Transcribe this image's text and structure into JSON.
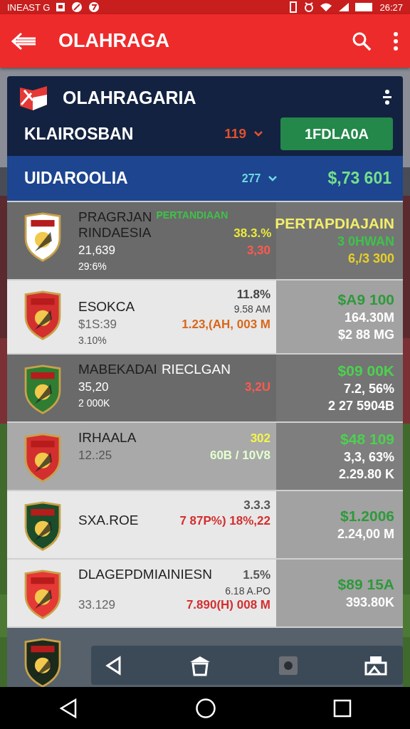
{
  "status_bar": {
    "carrier": "INEAST G",
    "time": "26:27"
  },
  "app_bar": {
    "title": "OLAHRAGA"
  },
  "card": {
    "title": "OLAHRAGARIA",
    "summary": {
      "label": "KLAIROSBAN",
      "count": "119",
      "button": "1FDLA0A"
    },
    "league": {
      "label": "UIDAROOLIA",
      "count": "277",
      "amount": "$,73 601"
    },
    "rows": [
      {
        "kind": "dark",
        "color": "#ffffff",
        "lines": [
          {
            "left": [
              {
                "kind": "name",
                "text": "PRAGRJAN RINDAESIA",
                "color": "#1e1e1e"
              },
              {
                "kind": "tag",
                "text": "PERTANDIAAN",
                "color": "#3fc24a"
              }
            ],
            "right": [
              {
                "kind": "value",
                "text": "38.3.%",
                "color": "#ecea3a"
              }
            ]
          },
          {
            "left": [
              {
                "kind": "stat",
                "text": "21,639",
                "color": "#ffffff"
              }
            ],
            "right": [
              {
                "kind": "value",
                "text": "3,30",
                "color": "#ff5a4f"
              }
            ]
          },
          {
            "left": [
              {
                "kind": "small",
                "text": "29:6%",
                "color": "#ffffff"
              }
            ]
          }
        ],
        "right": [
          {
            "text": "PERTAPDIAJAIN",
            "color": "#f2ee6a"
          },
          {
            "text": "3 0HWAN",
            "color": "#3fc24a"
          },
          {
            "text": "6,/3 300",
            "color": "#e5d02a"
          }
        ]
      },
      {
        "kind": "light",
        "color": "#d32f2f",
        "lines": [
          {
            "left": [
              {
                "kind": "name",
                "text": "ESOKCA",
                "color": "#1e1e1e"
              }
            ],
            "right": [
              {
                "kind": "value",
                "text": "11.8%",
                "color": "#444444"
              },
              {
                "kind": "small",
                "text": "9.58 AM",
                "color": "#444444"
              }
            ]
          },
          {
            "left": [
              {
                "kind": "stat",
                "text": "$1S:39",
                "color": "#666666"
              }
            ],
            "right": [
              {
                "kind": "value",
                "text": "1.23,(AH, 003 M",
                "color": "#d9661a"
              }
            ]
          },
          {
            "left": [
              {
                "kind": "small",
                "text": "3.10%",
                "color": "#555555"
              }
            ]
          }
        ],
        "right": [
          {
            "text": "$A9 100",
            "color": "#2e9a3a"
          },
          {
            "text": "164.30M",
            "color": "#ffffff"
          },
          {
            "text": "$2 88 MG",
            "color": "#ffffff"
          }
        ]
      },
      {
        "kind": "dark",
        "color": "#2e7d32",
        "lines": [
          {
            "left": [
              {
                "kind": "name",
                "text": "MABEKADAI",
                "color": "#1e1e1e"
              },
              {
                "kind": "name",
                "text": "RIECLGAN",
                "color": "#ffffff"
              }
            ]
          },
          {
            "left": [
              {
                "kind": "stat",
                "text": "35,20",
                "color": "#ffffff"
              }
            ],
            "right": [
              {
                "kind": "value",
                "text": "3,2U",
                "color": "#ff5a4f"
              }
            ]
          },
          {
            "left": [
              {
                "kind": "small",
                "text": "2 000K",
                "color": "#ffffff"
              }
            ]
          }
        ],
        "right": [
          {
            "text": "$09 00K",
            "color": "#4cd14f"
          },
          {
            "text": "7.2, 56%",
            "color": "#ffffff"
          },
          {
            "text": "2 27 5904B",
            "color": "#ffffff"
          }
        ]
      },
      {
        "kind": "medium",
        "color": "#d32f2f",
        "lines": [
          {
            "left": [
              {
                "kind": "name",
                "text": "IRHAALA",
                "color": "#1e1e1e"
              }
            ],
            "right": [
              {
                "kind": "value",
                "text": "302",
                "color": "#f4f64a"
              }
            ]
          },
          {
            "left": [
              {
                "kind": "stat",
                "text": "12.:25",
                "color": "#555555"
              }
            ],
            "right": [
              {
                "kind": "value",
                "text": "60B / 10V8",
                "color": "#e4ffd0"
              }
            ]
          }
        ],
        "right": [
          {
            "text": "$48 109",
            "color": "#4cd14f"
          },
          {
            "text": "3,3, 63%",
            "color": "#ffffff"
          },
          {
            "text": "2.29.80 K",
            "color": "#ffffff"
          }
        ]
      },
      {
        "kind": "light",
        "color": "#1b4d2a",
        "lines": [
          {
            "left": [
              {
                "kind": "name",
                "text": "SXA.ROE",
                "color": "#1e1e1e"
              }
            ],
            "right": [
              {
                "kind": "value",
                "text": "3.3.3",
                "color": "#555555"
              },
              {
                "kind": "value",
                "text": "7 87P%) 18%,22",
                "color": "#d32f2f"
              }
            ]
          }
        ],
        "right": [
          {
            "text": "$1.2006",
            "color": "#2e9a3a"
          },
          {
            "text": "2.24,00 M",
            "color": "#ffffff"
          }
        ]
      },
      {
        "kind": "light",
        "color": "#e53935",
        "lines": [
          {
            "left": [
              {
                "kind": "name",
                "text": "DLAGEPDMIAINIESN",
                "color": "#1e1e1e"
              }
            ],
            "right": [
              {
                "kind": "value",
                "text": "1.5%",
                "color": "#555555"
              }
            ]
          },
          {
            "left": [
              {
                "kind": "stat",
                "text": "33.129",
                "color": "#666666"
              }
            ],
            "right": [
              {
                "kind": "small",
                "text": "6.18 A.PO",
                "color": "#444444"
              },
              {
                "kind": "value",
                "text": "7.890(H) 008 M",
                "color": "#d32f2f"
              }
            ]
          }
        ],
        "right": [
          {
            "text": "$89 15A",
            "color": "#2e9a3a"
          },
          {
            "text": "393.80K",
            "color": "#ffffff"
          }
        ]
      },
      {
        "kind": "hidden",
        "color": "#1c2a1c"
      }
    ]
  }
}
